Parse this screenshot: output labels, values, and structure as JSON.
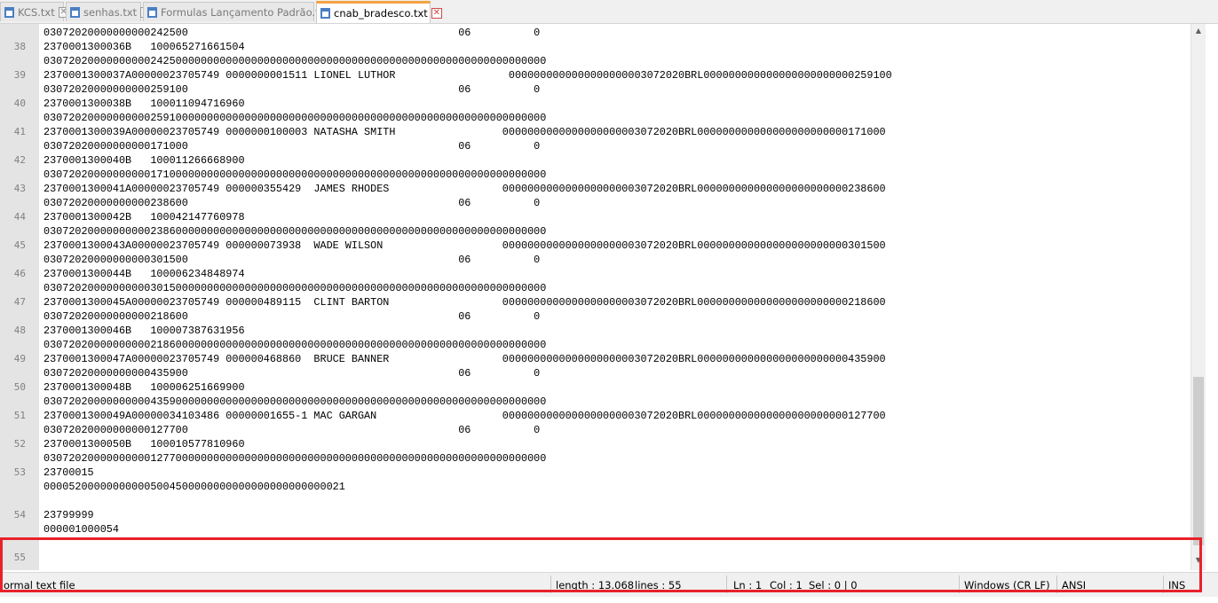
{
  "tabs": [
    {
      "label": "KCS.txt",
      "active": false
    },
    {
      "label": "senhas.txt",
      "active": false
    },
    {
      "label": "Formulas Lançamento Padrão.txt",
      "active": false
    },
    {
      "label": "cnab_bradesco.txt",
      "active": true
    }
  ],
  "editor": {
    "lines": [
      {
        "num": "",
        "text": "03072020000000000242500                                           06          0"
      },
      {
        "num": "38",
        "text": "2370001300036B   100065271661504"
      },
      {
        "num": "",
        "text": "03072020000000000242500000000000000000000000000000000000000000000000000000000000"
      },
      {
        "num": "39",
        "text": "2370001300037A00000023705749 0000000001511 LIONEL LUTHOR                  0000000000000000000003072020BRL000000000000000000000000259100"
      },
      {
        "num": "",
        "text": "03072020000000000259100                                           06          0"
      },
      {
        "num": "40",
        "text": "2370001300038B   100011094716960"
      },
      {
        "num": "",
        "text": "03072020000000000259100000000000000000000000000000000000000000000000000000000000"
      },
      {
        "num": "41",
        "text": "2370001300039A00000023705749 0000000100003 NATASHA SMITH                 0000000000000000000003072020BRL000000000000000000000000171000"
      },
      {
        "num": "",
        "text": "03072020000000000171000                                           06          0"
      },
      {
        "num": "42",
        "text": "2370001300040B   100011266668900"
      },
      {
        "num": "",
        "text": "03072020000000000171000000000000000000000000000000000000000000000000000000000000"
      },
      {
        "num": "43",
        "text": "2370001300041A00000023705749 000000355429  JAMES RHODES                  0000000000000000000003072020BRL000000000000000000000000238600"
      },
      {
        "num": "",
        "text": "03072020000000000238600                                           06          0"
      },
      {
        "num": "44",
        "text": "2370001300042B   100042147760978"
      },
      {
        "num": "",
        "text": "03072020000000000238600000000000000000000000000000000000000000000000000000000000"
      },
      {
        "num": "45",
        "text": "2370001300043A00000023705749 000000073938  WADE WILSON                   0000000000000000000003072020BRL000000000000000000000000301500"
      },
      {
        "num": "",
        "text": "03072020000000000301500                                           06          0"
      },
      {
        "num": "46",
        "text": "2370001300044B   100006234848974"
      },
      {
        "num": "",
        "text": "03072020000000000301500000000000000000000000000000000000000000000000000000000000"
      },
      {
        "num": "47",
        "text": "2370001300045A00000023705749 000000489115  CLINT BARTON                  0000000000000000000003072020BRL000000000000000000000000218600"
      },
      {
        "num": "",
        "text": "03072020000000000218600                                           06          0"
      },
      {
        "num": "48",
        "text": "2370001300046B   100007387631956"
      },
      {
        "num": "",
        "text": "03072020000000000218600000000000000000000000000000000000000000000000000000000000"
      },
      {
        "num": "49",
        "text": "2370001300047A00000023705749 000000468860  BRUCE BANNER                  0000000000000000000003072020BRL000000000000000000000000435900"
      },
      {
        "num": "",
        "text": "03072020000000000435900                                           06          0"
      },
      {
        "num": "50",
        "text": "2370001300048B   100006251669900"
      },
      {
        "num": "",
        "text": "03072020000000000435900000000000000000000000000000000000000000000000000000000000"
      },
      {
        "num": "51",
        "text": "2370001300049A00000034103486 00000001655-1 MAC GARGAN                    0000000000000000000003072020BRL000000000000000000000000127700"
      },
      {
        "num": "",
        "text": "03072020000000000127700                                           06          0"
      },
      {
        "num": "52",
        "text": "2370001300050B   100010577810960"
      },
      {
        "num": "",
        "text": "03072020000000000127700000000000000000000000000000000000000000000000000000000000"
      },
      {
        "num": "53",
        "text": "23700015"
      },
      {
        "num": "",
        "text": "000052000000000005004500000000000000000000000021"
      },
      {
        "num": "",
        "text": ""
      },
      {
        "num": "54",
        "text": "23799999"
      },
      {
        "num": "",
        "text": "000001000054"
      },
      {
        "num": "",
        "text": ""
      },
      {
        "num": "55",
        "text": ""
      }
    ]
  },
  "statusbar": {
    "file_type": "ormal text file",
    "length": "length : 13.068",
    "lines": "lines : 55",
    "ln": "Ln : 1",
    "col": "Col : 1",
    "sel": "Sel : 0 | 0",
    "eol": "Windows (CR LF)",
    "encoding": "ANSI",
    "mode": "INS"
  },
  "icons": {
    "tab_file": "file-icon",
    "tab_close": "close-icon",
    "scroll_up": "arrow-up-icon",
    "scroll_down": "arrow-down-icon"
  },
  "colors": {
    "highlight": "#e8222a",
    "active_tab_accent": "#f4a341",
    "gutter": "#e4e4e4"
  }
}
